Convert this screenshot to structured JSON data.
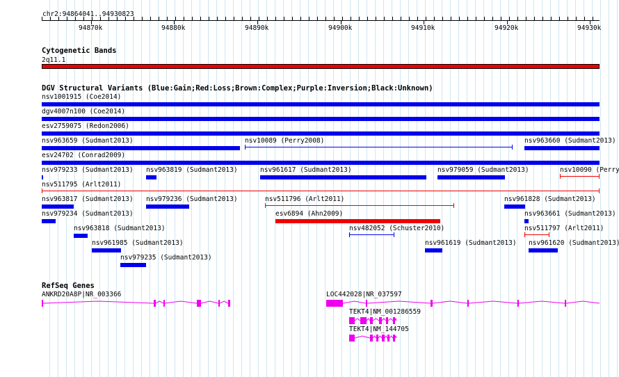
{
  "ruler": {
    "position_label": "chr2:94864041..94930823",
    "ticks": [
      "94870k",
      "94880k",
      "94890k",
      "94900k",
      "94910k",
      "94920k",
      "94930k"
    ]
  },
  "cytoband": {
    "title": "Cytogenetic Bands",
    "label": "2q11.1",
    "color": "#ee0000"
  },
  "dgv": {
    "title": "DGV Structural Variants (Blue:Gain;Red:Loss;Brown:Complex;Purple:Inversion;Black:Unknown)",
    "colors": {
      "gain": "#0000ee",
      "loss": "#ee0000"
    },
    "features": [
      {
        "label": "nsv1001915 (Coe2014)",
        "type": "gain"
      },
      {
        "label": "dgv4007n100 (Coe2014)",
        "type": "gain"
      },
      {
        "label": "esv2759075 (Redon2006)",
        "type": "gain"
      },
      {
        "label": "nsv963659 (Sudmant2013)",
        "type": "gain"
      },
      {
        "label": "nsv10089 (Perry2008)",
        "type": "gain"
      },
      {
        "label": "nsv963660 (Sudmant2013)",
        "type": "gain"
      },
      {
        "label": "esv24702 (Conrad2009)",
        "type": "gain"
      },
      {
        "label": "nsv979233 (Sudmant2013)",
        "type": "gain"
      },
      {
        "label": "nsv963819 (Sudmant2013)",
        "type": "gain"
      },
      {
        "label": "nsv961617 (Sudmant2013)",
        "type": "gain"
      },
      {
        "label": "nsv979059 (Sudmant2013)",
        "type": "gain"
      },
      {
        "label": "nsv10090 (Perry",
        "type": "loss"
      },
      {
        "label": "nsv511795 (Arlt2011)",
        "type": "loss"
      },
      {
        "label": "nsv963817 (Sudmant2013)",
        "type": "gain"
      },
      {
        "label": "nsv979236 (Sudmant2013)",
        "type": "gain"
      },
      {
        "label": "nsv511796 (Arlt2011)",
        "type": "loss"
      },
      {
        "label": "nsv961828 (Sudmant2013)",
        "type": "gain"
      },
      {
        "label": "nsv979234 (Sudmant2013)",
        "type": "gain"
      },
      {
        "label": "esv6894 (Ahn2009)",
        "type": "loss"
      },
      {
        "label": "nsv963661 (Sudmant2013)",
        "type": "gain"
      },
      {
        "label": "nsv963818 (Sudmant2013)",
        "type": "gain"
      },
      {
        "label": "nsv482052 (Schuster2010)",
        "type": "gain"
      },
      {
        "label": "nsv511797 (Arlt2011)",
        "type": "loss"
      },
      {
        "label": "nsv961985 (Sudmant2013)",
        "type": "gain"
      },
      {
        "label": "nsv961619 (Sudmant2013)",
        "type": "gain"
      },
      {
        "label": "nsv961620 (Sudmant2013)",
        "type": "gain"
      },
      {
        "label": "nsv979235 (Sudmant2013)",
        "type": "gain"
      }
    ]
  },
  "genes": {
    "title": "RefSeq Genes",
    "color": "#ee00ee",
    "transcripts": [
      {
        "label": "ANKRD20A8P|NR_003366"
      },
      {
        "label": "LOC442028|NR_037597"
      },
      {
        "label": "TEKT4|NM_001286559"
      },
      {
        "label": "TEKT4|NM_144705"
      }
    ]
  }
}
